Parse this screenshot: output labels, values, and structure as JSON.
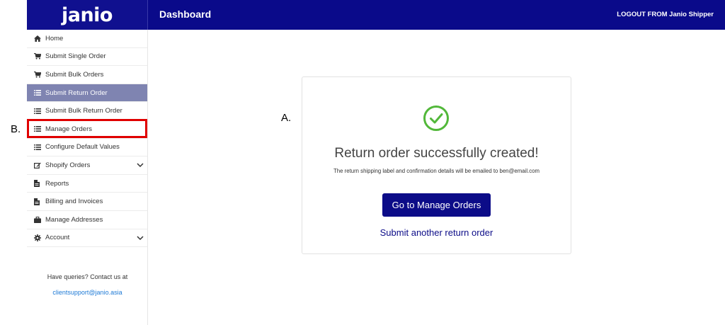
{
  "header": {
    "logo_text": "janio",
    "title": "Dashboard",
    "logout_label": "LOGOUT FROM Janio Shipper",
    "bg_color": "#0a0a8a"
  },
  "sidebar": {
    "items": [
      {
        "label": "Home",
        "icon": "home-icon"
      },
      {
        "label": "Submit Single Order",
        "icon": "cart-icon"
      },
      {
        "label": "Submit Bulk Orders",
        "icon": "cart-icon"
      },
      {
        "label": "Submit Return Order",
        "icon": "list-icon",
        "active": true
      },
      {
        "label": "Submit Bulk Return Order",
        "icon": "list-icon"
      },
      {
        "label": "Manage Orders",
        "icon": "list-icon"
      },
      {
        "label": "Configure Default Values",
        "icon": "list-icon"
      },
      {
        "label": "Shopify Orders",
        "icon": "edit-icon",
        "expandable": true
      },
      {
        "label": "Reports",
        "icon": "document-icon"
      },
      {
        "label": "Billing and Invoices",
        "icon": "document-icon"
      },
      {
        "label": "Manage Addresses",
        "icon": "briefcase-icon"
      },
      {
        "label": "Account",
        "icon": "gear-icon",
        "expandable": true
      }
    ],
    "help_text": "Have queries? Contact us at",
    "help_email": "clientsupport@janio.asia",
    "active_color": "#7f84b1"
  },
  "annotations": {
    "a_label": "A.",
    "b_label": "B.",
    "highlight_color": "#e00000"
  },
  "success": {
    "title": "Return order successfully created!",
    "subtitle": "The return shipping label and confirmation details will be emailed to ben@email.com",
    "primary_button": "Go to Manage Orders",
    "secondary_link": "Submit another return order",
    "check_color": "#52b83a"
  }
}
